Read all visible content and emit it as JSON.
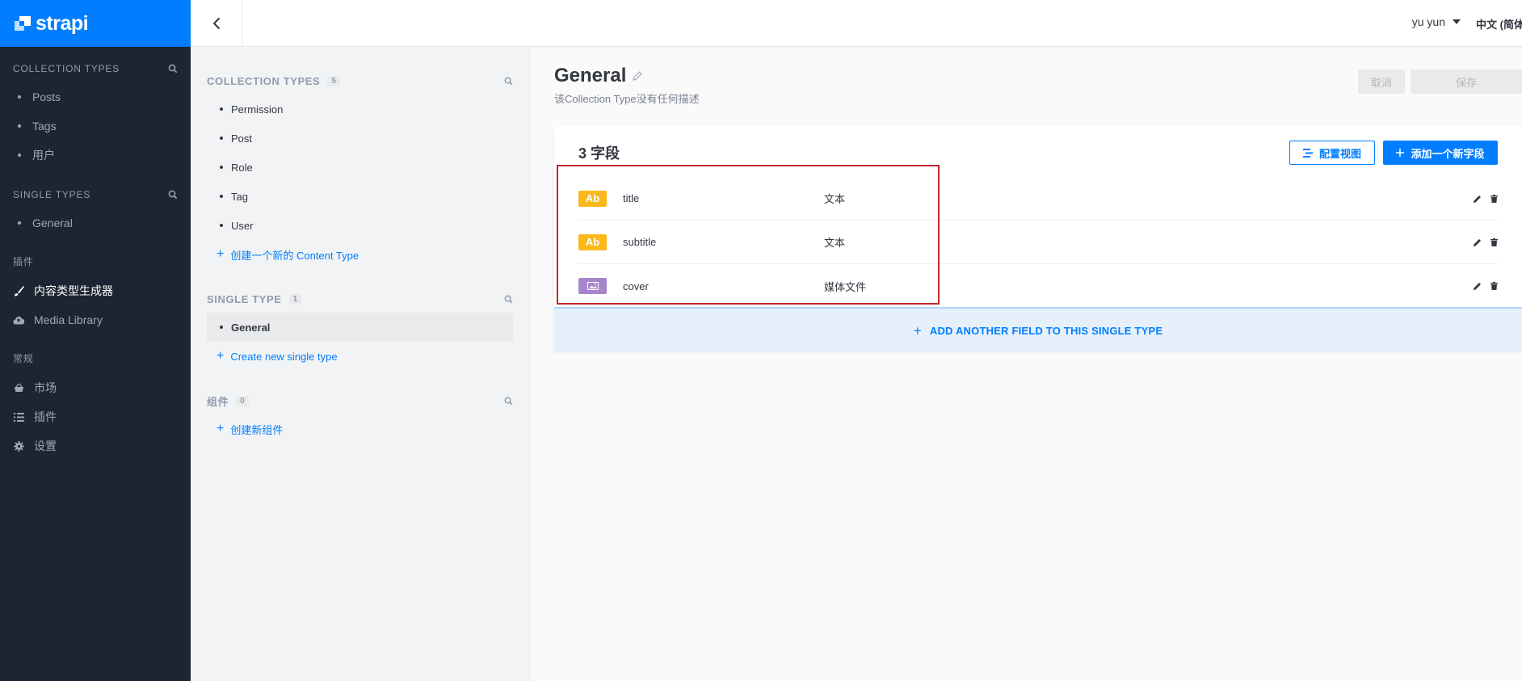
{
  "brand": {
    "name": "strapi"
  },
  "leftnav": {
    "collection_types": {
      "header": "COLLECTION TYPES",
      "items": [
        {
          "label": "Posts"
        },
        {
          "label": "Tags"
        },
        {
          "label": "用户"
        }
      ]
    },
    "single_types": {
      "header": "SINGLE TYPES",
      "items": [
        {
          "label": "General"
        }
      ]
    },
    "plugins": {
      "header": "插件",
      "items": [
        {
          "label": "内容类型生成器",
          "icon": "paintbrush-icon",
          "active": true
        },
        {
          "label": "Media Library",
          "icon": "cloud-upload-icon"
        }
      ]
    },
    "general": {
      "header": "常规",
      "items": [
        {
          "label": "市场",
          "icon": "basket-icon"
        },
        {
          "label": "插件",
          "icon": "list-icon"
        },
        {
          "label": "设置",
          "icon": "gear-icon"
        }
      ]
    }
  },
  "topbar": {
    "user": "yu yun",
    "language": "中文 (简体)"
  },
  "subnav": {
    "collection_types": {
      "header": "COLLECTION TYPES",
      "count": "5",
      "items": [
        {
          "label": "Permission"
        },
        {
          "label": "Post"
        },
        {
          "label": "Role"
        },
        {
          "label": "Tag"
        },
        {
          "label": "User"
        }
      ],
      "create_link": "创建一个新的 Content Type"
    },
    "single_type": {
      "header": "SINGLE TYPE",
      "count": "1",
      "items": [
        {
          "label": "General",
          "active": true
        }
      ],
      "create_link": "Create new single type"
    },
    "components": {
      "header": "组件",
      "count": "0",
      "create_link": "创建新组件"
    }
  },
  "main": {
    "title": "General",
    "description": "该Collection Type没有任何描述",
    "cancel_label": "取消",
    "save_label": "保存",
    "fields_title": "3 字段",
    "config_view_label": "配置视图",
    "add_field_label": "添加一个新字段",
    "fields": [
      {
        "badge": "Ab",
        "name": "title",
        "type": "文本",
        "kind": "text"
      },
      {
        "badge": "Ab",
        "name": "subtitle",
        "type": "文本",
        "kind": "text"
      },
      {
        "badge": "",
        "name": "cover",
        "type": "媒体文件",
        "kind": "media"
      }
    ],
    "add_another_label": "ADD ANOTHER FIELD TO THIS SINGLE TYPE"
  },
  "colors": {
    "brand_blue": "#007eff",
    "nav_bg": "#1c2531",
    "text_badge": "#fab81b",
    "media_badge": "#a585cc",
    "highlight_red": "#c1272d"
  }
}
